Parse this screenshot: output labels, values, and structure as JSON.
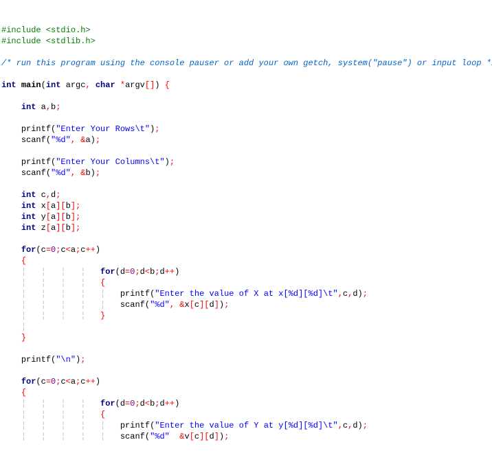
{
  "l1a": "#include ",
  "l1b": "<stdio.h>",
  "l2a": "#include ",
  "l2b": "<stdlib.h>",
  "cm1": "/* run this program using the console pauser or add your own getch, system(\"pause\") or input loop */",
  "kw_int": "int",
  "kw_char": "char",
  "kw_for": "for",
  "nm_main": "main",
  "nm_argc": "argc",
  "nm_argv": "argv",
  "sym_lp": "(",
  "sym_rp": ")",
  "sym_lb": "[",
  "sym_rb": "]",
  "sym_lc": "{",
  "sym_rc": "}",
  "sym_co": ",",
  "sym_sc": ";",
  "sym_star": "*",
  "sym_amp": "&",
  "var_a": "a",
  "var_b": "b",
  "var_c": "c",
  "var_d": "d",
  "var_x": "x",
  "var_y": "y",
  "var_z": "z",
  "fn_printf": "printf",
  "fn_scanf": "scanf",
  "str_rows": "\"Enter Your Rows\\t\"",
  "str_cols": "\"Enter Your Columns\\t\"",
  "str_d": "\"%d\"",
  "str_valx": "\"Enter the value of X at x[%d][%d]\\t\"",
  "str_valy": "\"Enter the value of Y at y[%d][%d]\\t\"",
  "str_nl": "\"\\n\"",
  "num_0": "0",
  "op_eq": "=",
  "op_lt": "<",
  "op_inc": "++",
  "g1": "¦   ",
  "g2": "¦   ¦   ¦   ¦   ",
  "g3": "¦   ¦   ¦   ¦   ¦   ",
  "truncated": "scanf(\"%d\"  &v[c][d]);"
}
